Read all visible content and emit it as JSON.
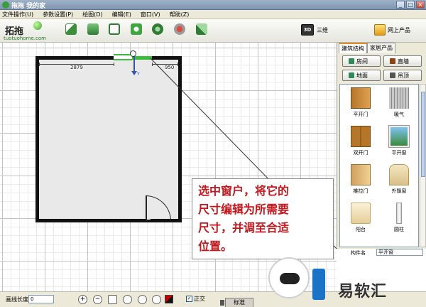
{
  "window": {
    "title": "拖拖 我的家",
    "min": "_",
    "max": "□",
    "close": "×"
  },
  "menu": [
    "文件操作(U)",
    "参数设置(P)",
    "绘图(D)",
    "编辑(E)",
    "窗口(V)",
    "帮助(Z)"
  ],
  "logo": {
    "mark": "拓拖",
    "url": "tuotuohome.com"
  },
  "toolbar": {
    "icons": [
      "new-icon",
      "open-icon",
      "save-icon",
      "undo-icon",
      "redo-icon",
      "record-icon",
      "refresh-icon"
    ],
    "view3d_badge": "3D",
    "view3d_label": "三维",
    "online_label": "网上产品"
  },
  "canvas": {
    "dim_left": "2879",
    "dim_right": "950",
    "axis_label": "Y"
  },
  "annotation": {
    "lines": [
      "选中窗户，将它的",
      "尺寸编辑为所需要",
      "尺寸，并调至合适",
      "位置。"
    ]
  },
  "status": {
    "length_label": "画线长度",
    "length_value": "0",
    "ortho_check": "✓",
    "ortho_label": "正交",
    "standard_tab": "标准"
  },
  "rpanel": {
    "tabs": [
      "建筑结构",
      "家居产品"
    ],
    "buttons": [
      "房间",
      "直墙",
      "地面",
      "吊顶"
    ],
    "items": [
      "平开门",
      "暖气",
      "双开门",
      "平开窗",
      "推拉门",
      "外飘窗",
      "阳台",
      "圆柱"
    ],
    "bottom_label": "构件名",
    "bottom_value": "平开窗"
  },
  "watermark": {
    "text": "易软汇"
  },
  "colors": {
    "accent_green": "#3dbb3d",
    "annotation_red": "#c4161c",
    "axis_blue": "#3355aa"
  }
}
